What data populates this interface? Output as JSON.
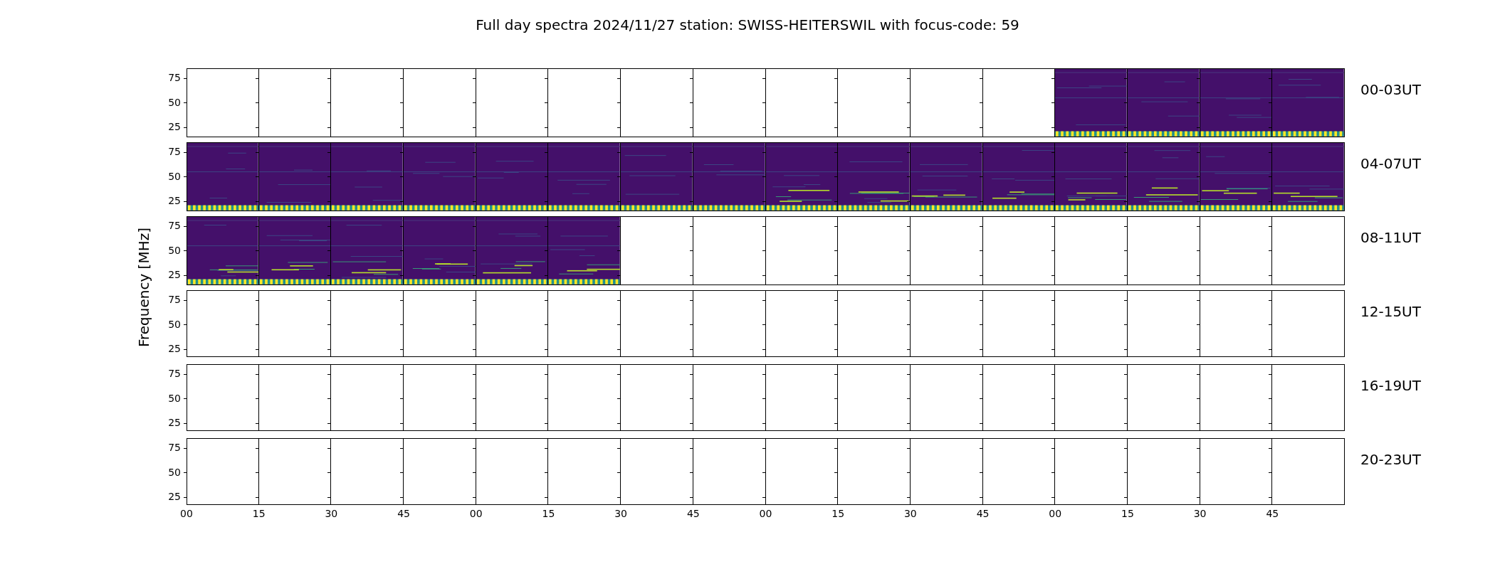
{
  "title": "Full day spectra 2024/11/27 station: SWISS-HEITERSWIL with focus-code: 59",
  "ylabel": "Frequency [MHz]",
  "xticks": [
    "00",
    "15",
    "30",
    "45",
    "00",
    "15",
    "30",
    "45",
    "00",
    "15",
    "30",
    "45",
    "00",
    "15",
    "30",
    "45"
  ],
  "rows": [
    {
      "label": "00-03UT",
      "yticks": [
        "75",
        "50",
        "25"
      ],
      "panels": [
        {
          "spectrum": false
        },
        {
          "spectrum": false
        },
        {
          "spectrum": false
        },
        {
          "spectrum": false
        },
        {
          "spectrum": false
        },
        {
          "spectrum": false
        },
        {
          "spectrum": false
        },
        {
          "spectrum": false
        },
        {
          "spectrum": false
        },
        {
          "spectrum": false
        },
        {
          "spectrum": false
        },
        {
          "spectrum": false
        },
        {
          "spectrum": true
        },
        {
          "spectrum": true
        },
        {
          "spectrum": true
        },
        {
          "spectrum": true
        }
      ]
    },
    {
      "label": "04-07UT",
      "yticks": [
        "75",
        "50",
        "25"
      ],
      "panels": [
        {
          "spectrum": true
        },
        {
          "spectrum": true
        },
        {
          "spectrum": true
        },
        {
          "spectrum": true
        },
        {
          "spectrum": true
        },
        {
          "spectrum": true
        },
        {
          "spectrum": true
        },
        {
          "spectrum": true
        },
        {
          "spectrum": true
        },
        {
          "spectrum": true
        },
        {
          "spectrum": true
        },
        {
          "spectrum": true
        },
        {
          "spectrum": true
        },
        {
          "spectrum": true
        },
        {
          "spectrum": true
        },
        {
          "spectrum": true
        }
      ]
    },
    {
      "label": "08-11UT",
      "yticks": [
        "75",
        "50",
        "25"
      ],
      "panels": [
        {
          "spectrum": true
        },
        {
          "spectrum": true
        },
        {
          "spectrum": true
        },
        {
          "spectrum": true
        },
        {
          "spectrum": true
        },
        {
          "spectrum": true
        },
        {
          "spectrum": false
        },
        {
          "spectrum": false
        },
        {
          "spectrum": false
        },
        {
          "spectrum": false
        },
        {
          "spectrum": false
        },
        {
          "spectrum": false
        },
        {
          "spectrum": false
        },
        {
          "spectrum": false
        },
        {
          "spectrum": false
        },
        {
          "spectrum": false
        }
      ]
    },
    {
      "label": "12-15UT",
      "yticks": [
        "75",
        "50",
        "25"
      ],
      "panels": [
        {
          "spectrum": false
        },
        {
          "spectrum": false
        },
        {
          "spectrum": false
        },
        {
          "spectrum": false
        },
        {
          "spectrum": false
        },
        {
          "spectrum": false
        },
        {
          "spectrum": false
        },
        {
          "spectrum": false
        },
        {
          "spectrum": false
        },
        {
          "spectrum": false
        },
        {
          "spectrum": false
        },
        {
          "spectrum": false
        },
        {
          "spectrum": false
        },
        {
          "spectrum": false
        },
        {
          "spectrum": false
        },
        {
          "spectrum": false
        }
      ]
    },
    {
      "label": "16-19UT",
      "yticks": [
        "75",
        "50",
        "25"
      ],
      "panels": [
        {
          "spectrum": false
        },
        {
          "spectrum": false
        },
        {
          "spectrum": false
        },
        {
          "spectrum": false
        },
        {
          "spectrum": false
        },
        {
          "spectrum": false
        },
        {
          "spectrum": false
        },
        {
          "spectrum": false
        },
        {
          "spectrum": false
        },
        {
          "spectrum": false
        },
        {
          "spectrum": false
        },
        {
          "spectrum": false
        },
        {
          "spectrum": false
        },
        {
          "spectrum": false
        },
        {
          "spectrum": false
        },
        {
          "spectrum": false
        }
      ]
    },
    {
      "label": "20-23UT",
      "yticks": [
        "75",
        "50",
        "25"
      ],
      "panels": [
        {
          "spectrum": false
        },
        {
          "spectrum": false
        },
        {
          "spectrum": false
        },
        {
          "spectrum": false
        },
        {
          "spectrum": false
        },
        {
          "spectrum": false
        },
        {
          "spectrum": false
        },
        {
          "spectrum": false
        },
        {
          "spectrum": false
        },
        {
          "spectrum": false
        },
        {
          "spectrum": false
        },
        {
          "spectrum": false
        },
        {
          "spectrum": false
        },
        {
          "spectrum": false
        },
        {
          "spectrum": false
        },
        {
          "spectrum": false
        }
      ]
    }
  ]
}
